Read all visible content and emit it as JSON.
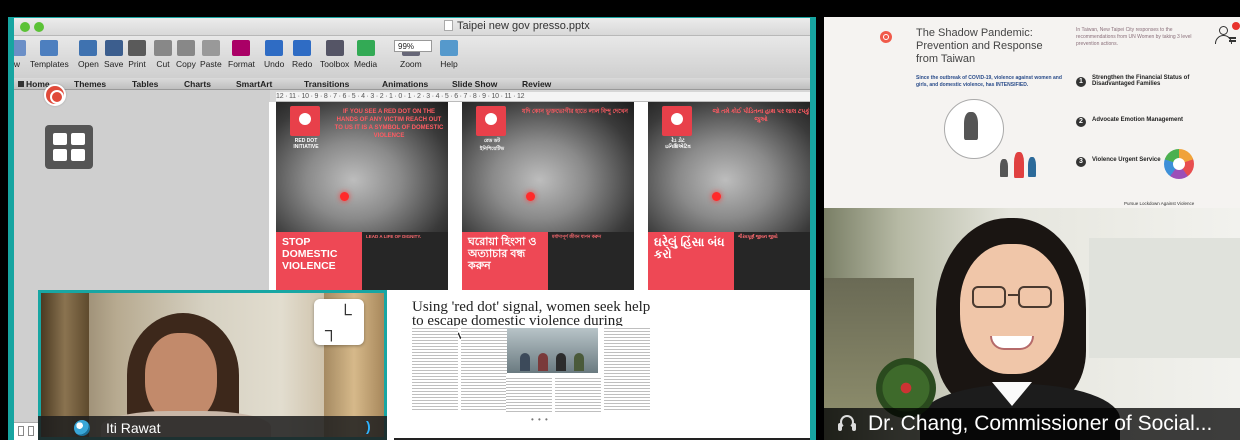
{
  "window": {
    "title": "Taipei new gov presso.pptx",
    "zoom": "99%"
  },
  "toolbar": {
    "items": [
      {
        "label": "w",
        "icon": "new-icon"
      },
      {
        "label": "Templates",
        "icon": "templates-icon"
      },
      {
        "label": "Open",
        "icon": "open-icon"
      },
      {
        "label": "Save",
        "icon": "save-icon"
      },
      {
        "label": "Print",
        "icon": "print-icon"
      },
      {
        "label": "Cut",
        "icon": "cut-icon"
      },
      {
        "label": "Copy",
        "icon": "copy-icon"
      },
      {
        "label": "Paste",
        "icon": "paste-icon"
      },
      {
        "label": "Format",
        "icon": "format-icon"
      },
      {
        "label": "Undo",
        "icon": "undo-icon"
      },
      {
        "label": "Redo",
        "icon": "redo-icon"
      },
      {
        "label": "Toolbox",
        "icon": "toolbox-icon"
      },
      {
        "label": "Media",
        "icon": "media-icon"
      },
      {
        "label": "Zoom",
        "icon": "zoom-icon"
      },
      {
        "label": "Help",
        "icon": "help-icon"
      }
    ]
  },
  "ribbon": {
    "tabs": [
      "Home",
      "Themes",
      "Tables",
      "Charts",
      "SmartArt",
      "Transitions",
      "Animations",
      "Slide Show",
      "Review"
    ]
  },
  "ruler": {
    "text": "12 · 11 · 10 · 9 · 8 · 7 · 6 · 5 · 4 · 3 · 2 · 1 · 0 · 1 · 2 · 3 · 4 · 5 · 6 · 7 · 8 · 9 · 10 · 11 · 12"
  },
  "slide": {
    "posters": [
      {
        "logo_text": "RED DOT INITIATIVE",
        "red_text": "IF YOU SEE A RED DOT ON THE HANDS OF ANY VICTIM REACH OUT TO US IT IS A SYMBOL OF DOMESTIC VIOLENCE",
        "banner": "STOP DOMESTIC VIOLENCE",
        "side_highlight": "LEAD A LIFE OF DIGNITY."
      },
      {
        "logo_text": "রেড ডট ইনিশিয়েটিভ",
        "red_text": "যদি কোন ভুক্তভোগীর হাতে লাল বিন্দু দেখেন",
        "banner": "ঘরোয়া হিংসা ও অত্যাচার বন্ধ করুন",
        "side_highlight": "মর্যাদাপূর্ণ জীবন যাপন করুন"
      },
      {
        "logo_text": "રેડ ડોટ ઇનિશિએટિવ",
        "red_text": "જો તમે કોઈ પીડિતના હાથ પર લાલ ટપકું જુઓ",
        "banner": "ઘરેલું હિંસા બંધ કરો",
        "side_highlight": "ગૌરવપૂર્ણ જીવન જીવો"
      }
    ],
    "article_title": "Using 'red dot' signal, women seek help to escape domestic violence during lockdown"
  },
  "self_view": {
    "name": "Iti Rawat"
  },
  "presentation": {
    "title": "The Shadow Pandemic: Prevention and Response from Taiwan",
    "intro": "Since the outbreak of COVID-19, violence against women and girls, and domestic violence, has INTENSIFIED.",
    "right_intro": "In Taiwan, New Taipei City responses to the recommendations from UN Women by taking 3 level prevention actions.",
    "sections": [
      {
        "num": "1",
        "title": "Strengthen the Financial Status of Disadvantaged Families"
      },
      {
        "num": "2",
        "title": "Advocate Emotion Management"
      },
      {
        "num": "3",
        "title": "Violence Urgent Service"
      }
    ],
    "footer": "Pursue Lockdown Against Violence"
  },
  "speaker": {
    "name": "Dr. Chang, Commissioner of Social..."
  },
  "colors": {
    "tile_border": "#17a5a1",
    "poster_red": "#ee4855",
    "record_red": "#e04a3a",
    "audio_blue": "#2fb4ff"
  }
}
